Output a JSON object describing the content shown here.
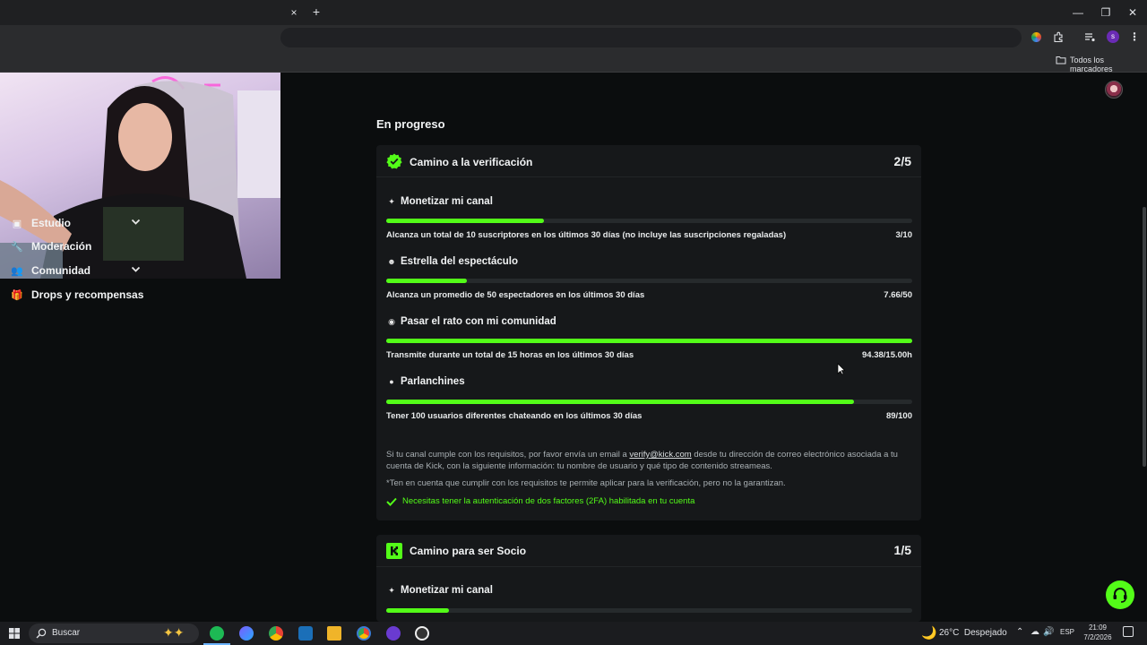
{
  "browser": {
    "new_tab_symbol": "+",
    "close_tab_symbol": "×",
    "window_controls": {
      "minimize": "—",
      "restore": "❐",
      "close": "✕"
    },
    "bookmarks_label": "Todos los marcadores",
    "profile_initial": "s"
  },
  "sidebar": {
    "items": [
      {
        "label": "Estudio",
        "icon": "studio-icon",
        "expandable": true
      },
      {
        "label": "Moderación",
        "icon": "wrench-icon",
        "expandable": false
      },
      {
        "label": "Comunidad",
        "icon": "people-icon",
        "expandable": true
      },
      {
        "label": "Drops y recompensas",
        "icon": "gift-icon",
        "expandable": false
      }
    ]
  },
  "main": {
    "section_title": "En progreso",
    "verification": {
      "title": "Camino a la verificación",
      "count": "2/5",
      "tasks": [
        {
          "title": "Monetizar mi canal",
          "icon": "sparkle-icon",
          "desc": "Alcanza un total de 10 suscriptores en los últimos 30 días (no incluye las suscripciones regaladas)",
          "value": "3/10",
          "progress": 0.3
        },
        {
          "title": "Estrella del espectáculo",
          "icon": "users-icon",
          "desc": "Alcanza un promedio de 50 espectadores en los últimos 30 días",
          "value": "7.66/50",
          "progress": 0.153
        },
        {
          "title": "Pasar el rato con mi comunidad",
          "icon": "broadcast-icon",
          "desc": "Transmite durante un total de 15 horas en los últimos 30 días",
          "value": "94.38/15.00h",
          "progress": 1.0
        },
        {
          "title": "Parlanchines",
          "icon": "chat-icon",
          "desc": "Tener 100 usuarios diferentes chateando en los últimos 30 días",
          "value": "89/100",
          "progress": 0.89
        }
      ],
      "note_before_link": "Si tu canal cumple con los requisitos, por favor envía un email a ",
      "note_link": "verify@kick.com",
      "note_after_link": " desde tu dirección de correo electrónico asociada a tu cuenta de Kick, con la siguiente información: tu nombre de usuario y qué tipo de contenido streameas.",
      "disclaimer": "*Ten en cuenta que cumplir con los requisitos te permite aplicar para la verificación, pero no la garantizan.",
      "twofa": "Necesitas tener la autenticación de dos factores (2FA) habilitada en tu cuenta"
    },
    "partner": {
      "title": "Camino para ser Socio",
      "count": "1/5",
      "first_task_title": "Monetizar mi canal",
      "first_task_icon": "sparkle-icon",
      "first_task_progress": 0.12
    }
  },
  "taskbar": {
    "search_placeholder": "Buscar",
    "weather": "26°C  Despejado",
    "language": "ESP",
    "time": "21:09",
    "date": "7/2/2026"
  },
  "colors": {
    "accent": "#53fc18",
    "card": "#16181a",
    "background": "#0b0d0e"
  }
}
